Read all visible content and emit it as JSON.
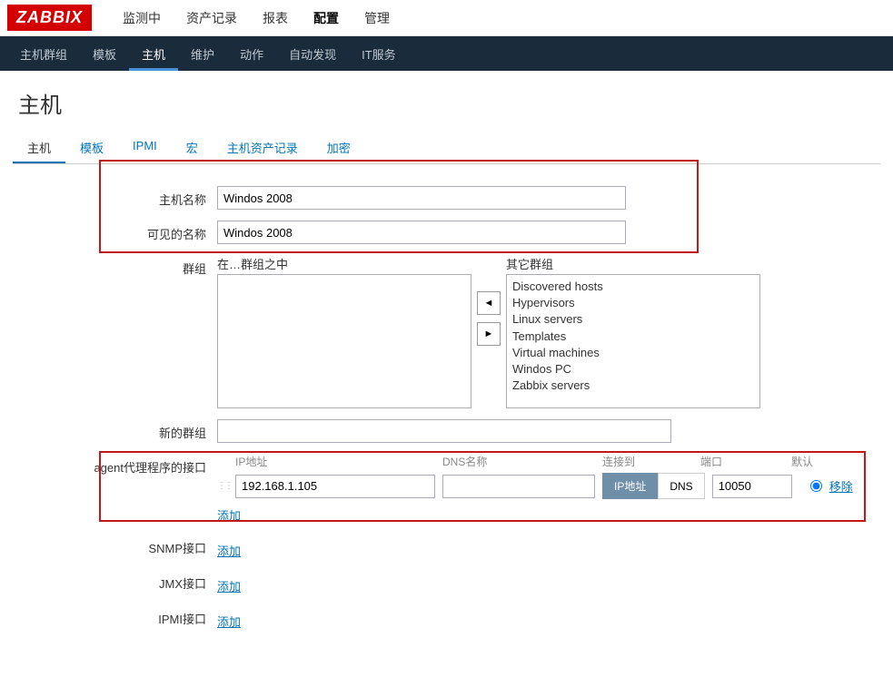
{
  "logo": "ZABBIX",
  "topnav": {
    "items": [
      "监测中",
      "资产记录",
      "报表",
      "配置",
      "管理"
    ],
    "activeIndex": 3
  },
  "subnav": {
    "items": [
      "主机群组",
      "模板",
      "主机",
      "维护",
      "动作",
      "自动发现",
      "IT服务"
    ],
    "activeIndex": 2
  },
  "pageTitle": "主机",
  "tabs": {
    "items": [
      "主机",
      "模板",
      "IPMI",
      "宏",
      "主机资产记录",
      "加密"
    ],
    "activeIndex": 0
  },
  "form": {
    "hostName": {
      "label": "主机名称",
      "value": "Windos 2008"
    },
    "visibleName": {
      "label": "可见的名称",
      "value": "Windos 2008"
    },
    "groups": {
      "label": "群组",
      "inLabel": "在…群组之中",
      "otherLabel": "其它群组",
      "inItems": [],
      "otherItems": [
        "Discovered hosts",
        "Hypervisors",
        "Linux servers",
        "Templates",
        "Virtual machines",
        "Windos PC",
        "Zabbix servers"
      ]
    },
    "newGroup": {
      "label": "新的群组",
      "value": ""
    },
    "agentIface": {
      "label": "agent代理程序的接口",
      "headers": {
        "ip": "IP地址",
        "dns": "DNS名称",
        "connect": "连接到",
        "port": "端口",
        "default": "默认"
      },
      "ip": "192.168.1.105",
      "dns": "",
      "connectIp": "IP地址",
      "connectDns": "DNS",
      "port": "10050",
      "remove": "移除",
      "add": "添加"
    },
    "snmpIface": {
      "label": "SNMP接口",
      "add": "添加"
    },
    "jmxIface": {
      "label": "JMX接口",
      "add": "添加"
    },
    "ipmiIface": {
      "label": "IPMI接口",
      "add": "添加"
    }
  }
}
